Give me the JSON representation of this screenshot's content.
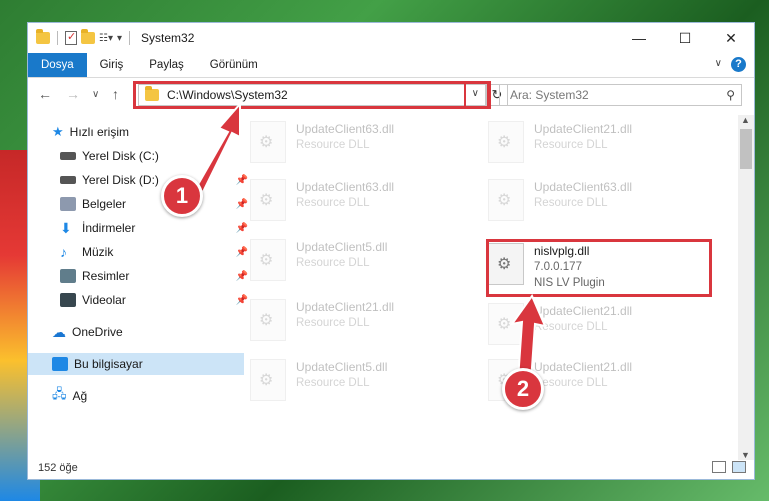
{
  "window": {
    "title": "System32",
    "controls": {
      "minimize": "—",
      "maximize": "☐",
      "close": "✕"
    }
  },
  "ribbon": {
    "tabs": [
      "Dosya",
      "Giriş",
      "Paylaş",
      "Görünüm"
    ],
    "help": "?"
  },
  "address": {
    "path": "C:\\Windows\\System32",
    "refresh": "↻"
  },
  "search": {
    "placeholder": "Ara: System32"
  },
  "sidebar": {
    "items": [
      {
        "label": "Hızlı erişim",
        "icon": "star-icon",
        "color": "#1e88e5"
      },
      {
        "label": "Yerel Disk (C:)",
        "icon": "drive-icon",
        "color": "#555555"
      },
      {
        "label": "Yerel Disk (D:)",
        "icon": "drive-icon",
        "color": "#555555"
      },
      {
        "label": "Belgeler",
        "icon": "documents-icon",
        "color": "#8d99ae"
      },
      {
        "label": "İndirmeler",
        "icon": "downloads-icon",
        "color": "#1e88e5"
      },
      {
        "label": "Müzik",
        "icon": "music-icon",
        "color": "#1e88e5"
      },
      {
        "label": "Resimler",
        "icon": "pictures-icon",
        "color": "#607d8b"
      },
      {
        "label": "Videolar",
        "icon": "videos-icon",
        "color": "#37474f"
      },
      {
        "label": "OneDrive",
        "icon": "cloud-icon",
        "color": "#1976d2"
      },
      {
        "label": "Bu bilgisayar",
        "icon": "computer-icon",
        "color": "#1e88e5"
      },
      {
        "label": "Ağ",
        "icon": "network-icon",
        "color": "#1e88e5"
      }
    ]
  },
  "files": [
    {
      "name": "UpdateClient63.dll",
      "type": "Resource DLL",
      "faded": true
    },
    {
      "name": "UpdateClient21.dll",
      "type": "Resource DLL",
      "faded": true
    },
    {
      "name": "UpdateClient63.dll",
      "type": "Resource DLL",
      "faded": true
    },
    {
      "name": "UpdateClient63.dll",
      "type": "Resource DLL",
      "faded": true
    },
    {
      "name": "UpdateClient5.dll",
      "type": "Resource DLL",
      "faded": true
    },
    {
      "name": "nislvplg.dll",
      "version": "7.0.0.177",
      "type": "NIS LV Plugin",
      "faded": false
    },
    {
      "name": "UpdateClient21.dll",
      "type": "Resource DLL",
      "faded": true
    },
    {
      "name": "UpdateClient21.dll",
      "type": "Resource DLL",
      "faded": true
    },
    {
      "name": "UpdateClient5.dll",
      "type": "Resource DLL",
      "faded": true
    },
    {
      "name": "UpdateClient21.dll",
      "type": "Resource DLL",
      "faded": true
    }
  ],
  "status": {
    "item_count": "152 öğe"
  },
  "callouts": [
    "1",
    "2"
  ],
  "accent": "#d9363e"
}
